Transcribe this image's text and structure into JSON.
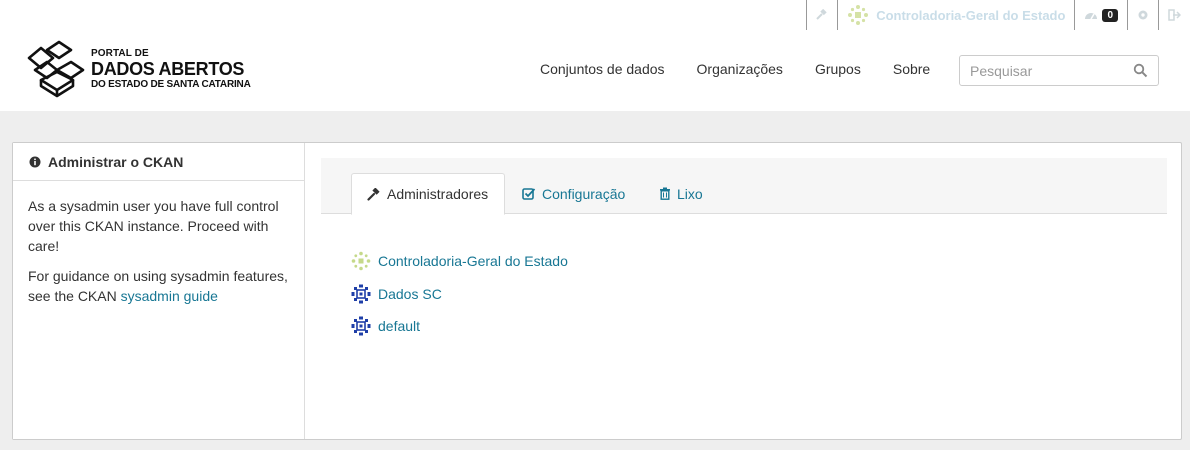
{
  "account": {
    "user_name": "Controladoria-Geral do Estado",
    "activity_count": "0",
    "icons": [
      "gavel-icon",
      "user-avatar",
      "dashboard-icon",
      "gear-icon",
      "sign-out-icon"
    ]
  },
  "logo": {
    "line1": "PORTAL DE",
    "line2": "DADOS ABERTOS",
    "line3": "DO ESTADO DE SANTA CATARINA"
  },
  "nav": {
    "items": [
      "Conjuntos de dados",
      "Organizações",
      "Grupos",
      "Sobre"
    ]
  },
  "search": {
    "placeholder": "Pesquisar",
    "icon": "search-icon"
  },
  "sidebar": {
    "heading": "Administrar o CKAN",
    "heading_icon": "info-circle-icon",
    "para1": "As a sysadmin user you have full control over this CKAN instance. Proceed with care!",
    "para2_prefix": "For guidance on using sysadmin features, see the CKAN ",
    "para2_link": "sysadmin guide"
  },
  "tabs": [
    {
      "label": "Administradores",
      "icon": "gavel-icon",
      "active": true
    },
    {
      "label": "Configuração",
      "icon": "check-square-icon",
      "active": false
    },
    {
      "label": "Lixo",
      "icon": "trash-icon",
      "active": false
    }
  ],
  "admins": [
    {
      "name": "Controladoria-Geral do Estado",
      "avatar_color": "#c5d98a"
    },
    {
      "name": "Dados SC",
      "avatar_color": "#1f3fa8"
    },
    {
      "name": "default",
      "avatar_color": "#1f3fa8"
    }
  ],
  "colors": {
    "link": "#187794",
    "background": "#eeeeee"
  }
}
